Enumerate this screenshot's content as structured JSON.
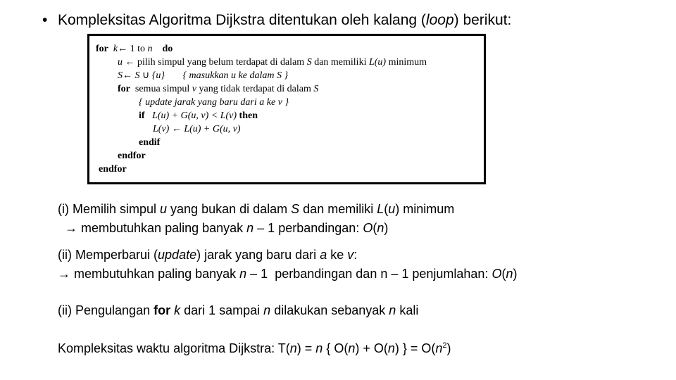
{
  "slide": {
    "title": {
      "bullet": "•",
      "prefix": "Kompleksitas Algoritma Dijkstra ditentukan oleh kalang (",
      "italic": "loop",
      "suffix": ") berikut:"
    },
    "algorithm": {
      "line1": {
        "kw1": "for",
        "k": "k",
        "arrow": "←",
        "range": "1 to",
        "n": "n",
        "kw2": "do"
      },
      "line2": {
        "u": "u",
        "arrow": "←",
        "text1": "pilih simpul yang belum terdapat di dalam",
        "S": "S",
        "text2": "dan memiliki",
        "Lu": "L(u)",
        "text3": "minimum"
      },
      "line3": {
        "S1": "S",
        "arrow": "←",
        "S2": "S",
        "union": "∪",
        "u": "{u}",
        "comment": "{ masukkan u ke dalam S }"
      },
      "line4": {
        "kw": "for",
        "text1": "semua simpul",
        "v": "v",
        "text2": "yang tidak terdapat di dalam",
        "S": "S"
      },
      "line5": {
        "comment": "{ update jarak yang baru dari a ke v }"
      },
      "line6": {
        "kw1": "if",
        "expr": "L(u) + G(u, v) < L(v)",
        "kw2": "then"
      },
      "line7": {
        "expr": "L(v) ← L(u) + G(u, v)"
      },
      "line8": {
        "kw": "endif"
      },
      "line9": {
        "kw": "endfor"
      },
      "line10": {
        "kw": "endfor"
      }
    },
    "points": {
      "p1": {
        "label": "(i) Memilih simpul ",
        "u": "u",
        "t1": " yang bukan di dalam ",
        "S": "S",
        "t2": " dan memiliki ",
        "Lu": "L",
        "Lu_paren_open": "(",
        "Lu_u": "u",
        "Lu_paren_close": ")",
        "t3": " minimum",
        "arrow": "→",
        "t4": " membutuhkan paling banyak ",
        "n": "n",
        "t5": " – 1 perbandingan: ",
        "O": "O",
        "On_open": "(",
        "On_n": "n",
        "On_close": ")"
      },
      "p2": {
        "label": "(ii) Memperbarui (",
        "update": "update",
        "t1": ") jarak yang baru dari ",
        "a": "a",
        "t2": " ke ",
        "v": "v",
        "t3": ":",
        "arrow": "→",
        "t4": " membutuhkan paling banyak ",
        "n": "n",
        "t5": " – 1  perbandingan dan n – 1 penjumlahan: ",
        "O": "O",
        "On_open": "(",
        "On_n": "n",
        "On_close": ")"
      },
      "p3": {
        "label": "(ii) Pengulangan ",
        "for": "for",
        "sp": " ",
        "k": "k",
        "t1": " dari 1 sampai ",
        "n1": "n",
        "t2": " dilakukan sebanyak ",
        "n2": "n",
        "t3": " kali"
      },
      "p4": {
        "label": "Kompleksitas waktu algoritma Dijkstra: T(",
        "n1": "n",
        "t1": ") = ",
        "n2": "n",
        "t2": " { O(",
        "n3": "n",
        "t3": ") + O(",
        "n4": "n",
        "t4": ") } = O(",
        "n5": "n",
        "sup": "2",
        "t5": ")"
      }
    }
  }
}
